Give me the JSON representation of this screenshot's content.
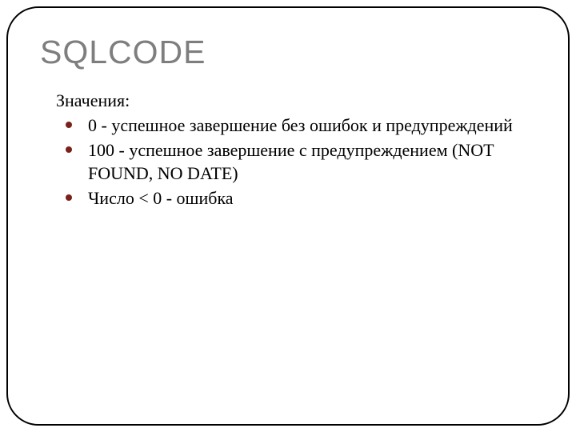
{
  "title": "SQLCODE",
  "intro": "Значения:",
  "items": [
    "0 - успешное завершение без ошибок и предупреждений",
    "100 - успешное завершение с предупреждением (NOT FOUND, NO DATE)",
    "Число < 0 - ошибка"
  ]
}
